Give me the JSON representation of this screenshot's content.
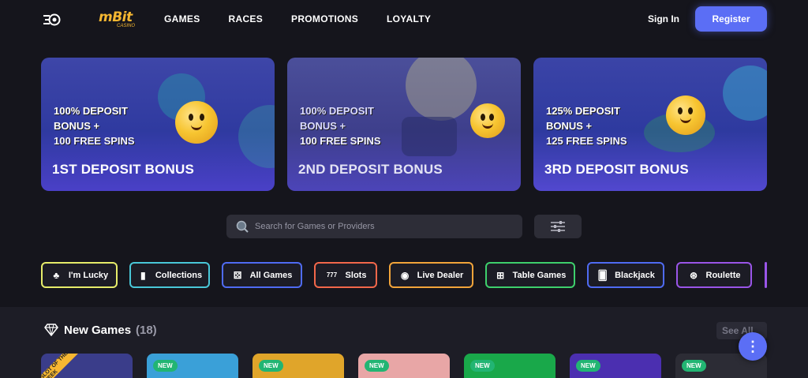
{
  "header": {
    "logo_text": "mBit",
    "logo_sub": "CASINO",
    "nav": [
      "GAMES",
      "RACES",
      "PROMOTIONS",
      "LOYALTY"
    ],
    "signin_label": "Sign In",
    "register_label": "Register",
    "accent_color": "#5b6ef5"
  },
  "banners": [
    {
      "bonus_lines": [
        "100% DEPOSIT",
        "BONUS +",
        "100 FREE SPINS"
      ],
      "title": "1ST DEPOSIT BONUS"
    },
    {
      "bonus_lines": [
        "100% DEPOSIT",
        "BONUS +",
        "100 FREE SPINS"
      ],
      "title": "2ND DEPOSIT BONUS"
    },
    {
      "bonus_lines": [
        "125% DEPOSIT",
        "BONUS +",
        "125 FREE SPINS"
      ],
      "title": "3RD DEPOSIT BONUS"
    }
  ],
  "search": {
    "placeholder": "Search for Games or Providers",
    "icon": "search-icon"
  },
  "filter": {
    "icon": "sliders-icon"
  },
  "categories": [
    {
      "label": "I'm Lucky",
      "icon": "clover-icon",
      "color": "#e6ec6a"
    },
    {
      "label": "Collections",
      "icon": "collections-icon",
      "color": "#49c7d8"
    },
    {
      "label": "All Games",
      "icon": "dice-icon",
      "color": "#4f6bf2"
    },
    {
      "label": "Slots",
      "icon": "slot-777-icon",
      "color": "#f2674a"
    },
    {
      "label": "Live Dealer",
      "icon": "live-dealer-icon",
      "color": "#f2a43a"
    },
    {
      "label": "Table Games",
      "icon": "table-games-icon",
      "color": "#3ed06c"
    },
    {
      "label": "Blackjack",
      "icon": "cards-icon",
      "color": "#4f6bf2"
    },
    {
      "label": "Roulette",
      "icon": "roulette-icon",
      "color": "#9a55e8"
    }
  ],
  "new_games": {
    "title": "New Games",
    "count": "(18)",
    "see_all": "See All",
    "fab_label": "⋮",
    "tiles": [
      {
        "badge": "SLOT OF THE WEEK",
        "color": "#3a3d8a"
      },
      {
        "badge": "NEW",
        "color": "#3aa0d8"
      },
      {
        "badge": "NEW",
        "color": "#e0a52a"
      },
      {
        "badge": "NEW",
        "color": "#e8a6a6"
      },
      {
        "badge": "NEW",
        "color": "#19a84a"
      },
      {
        "badge": "NEW",
        "color": "#4b2fb0"
      },
      {
        "badge": "NEW",
        "color": "#2c2c35"
      }
    ]
  }
}
